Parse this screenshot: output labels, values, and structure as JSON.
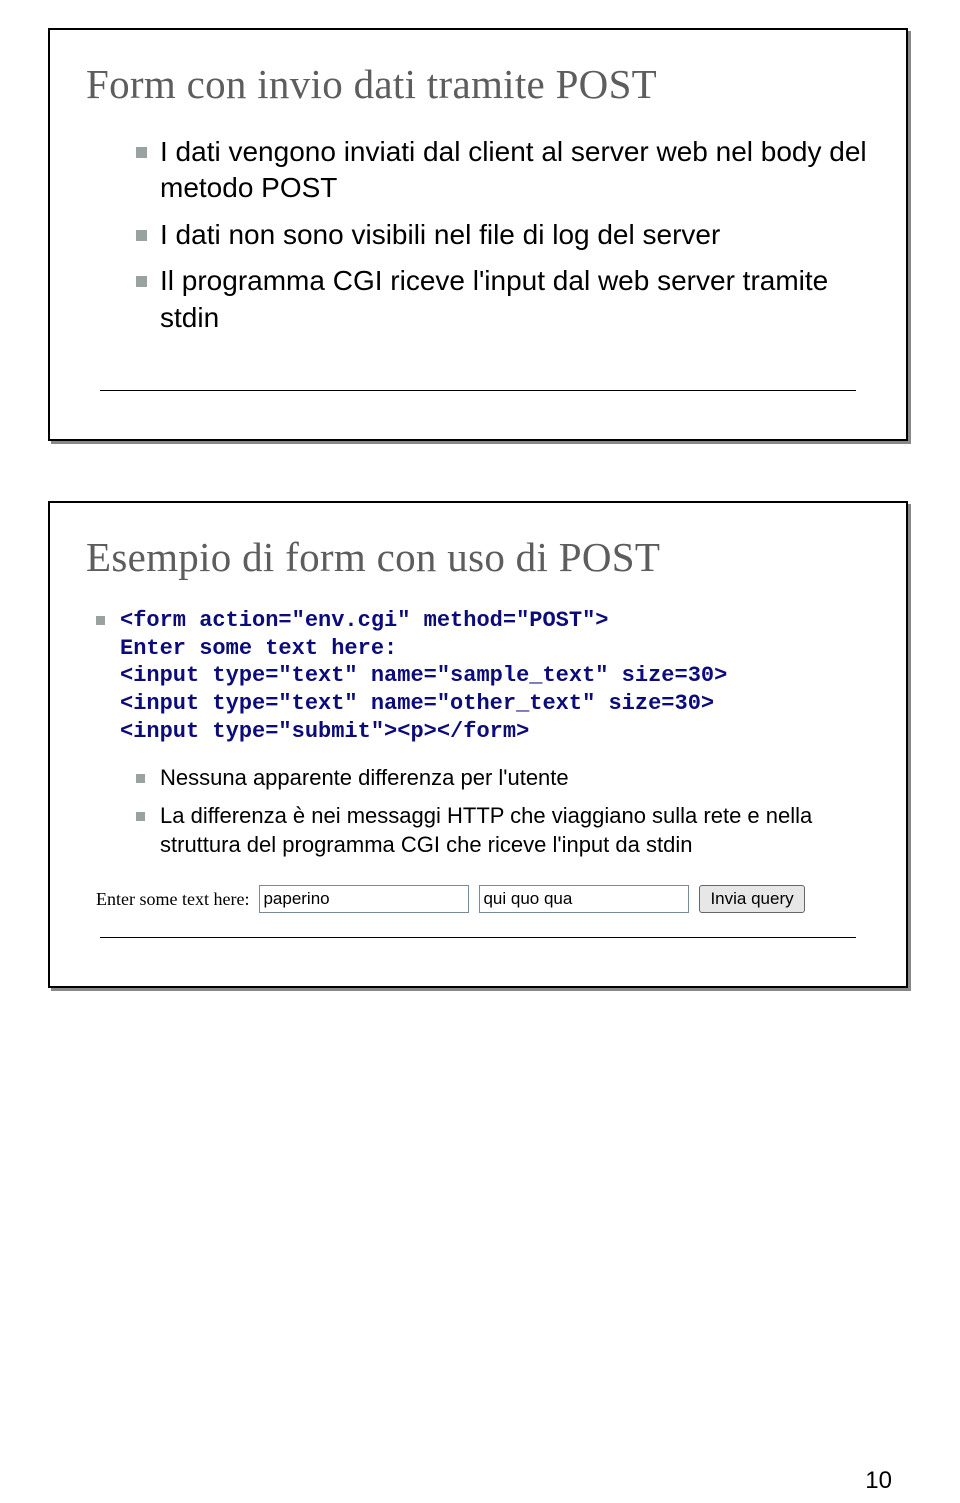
{
  "slide1": {
    "title": "Form con invio dati tramite POST",
    "bullets": [
      "I dati vengono inviati dal client al server web nel body del metodo POST",
      "I dati non sono visibili nel file di log del server",
      "Il programma CGI riceve l'input dal web server tramite stdin"
    ]
  },
  "slide2": {
    "title": "Esempio di form con uso di POST",
    "code": {
      "l1": "<form action=\"env.cgi\" method=\"POST\">",
      "l2": "Enter some text here:",
      "l3": "<input type=\"text\" name=\"sample_text\" size=30>",
      "l4": "<input type=\"text\" name=\"other_text\" size=30>",
      "l5": "<input type=\"submit\"><p></form>"
    },
    "bullets": [
      "Nessuna apparente differenza per l'utente",
      "La differenza è nei messaggi HTTP che viaggiano sulla rete e nella struttura del programma CGI che riceve l'input da stdin"
    ],
    "form": {
      "label": "Enter some text here:",
      "input1_value": "paperino",
      "input2_value": "qui quo qua",
      "button_label": "Invia query"
    }
  },
  "page_number": "10"
}
